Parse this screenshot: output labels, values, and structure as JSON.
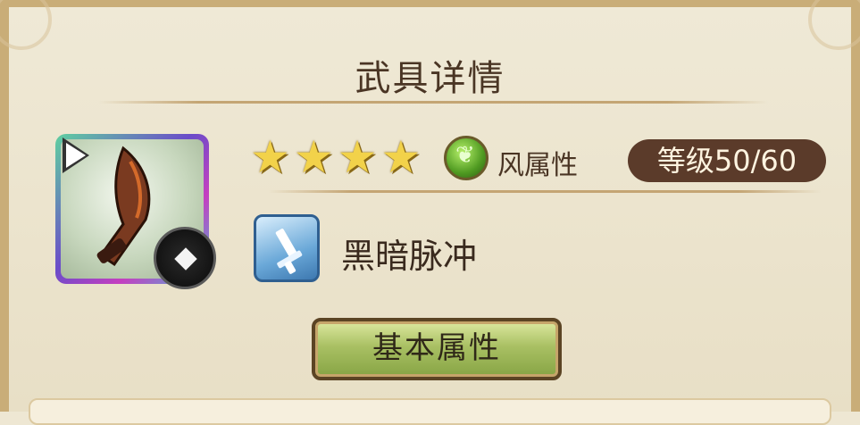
{
  "header": {
    "title": "武具详情"
  },
  "weapon": {
    "rarity_stars": 4,
    "attribute_label": "风属性",
    "attribute_color": "#6dc236",
    "level_text": "等级50/60"
  },
  "skill": {
    "name": "黑暗脉冲"
  },
  "tabs": {
    "basic_label": "基本属性"
  },
  "colors": {
    "title_text": "#4a3524",
    "level_bg": "#5b3b2a",
    "star": "#f2d24a",
    "button_green": "#a9c063"
  }
}
